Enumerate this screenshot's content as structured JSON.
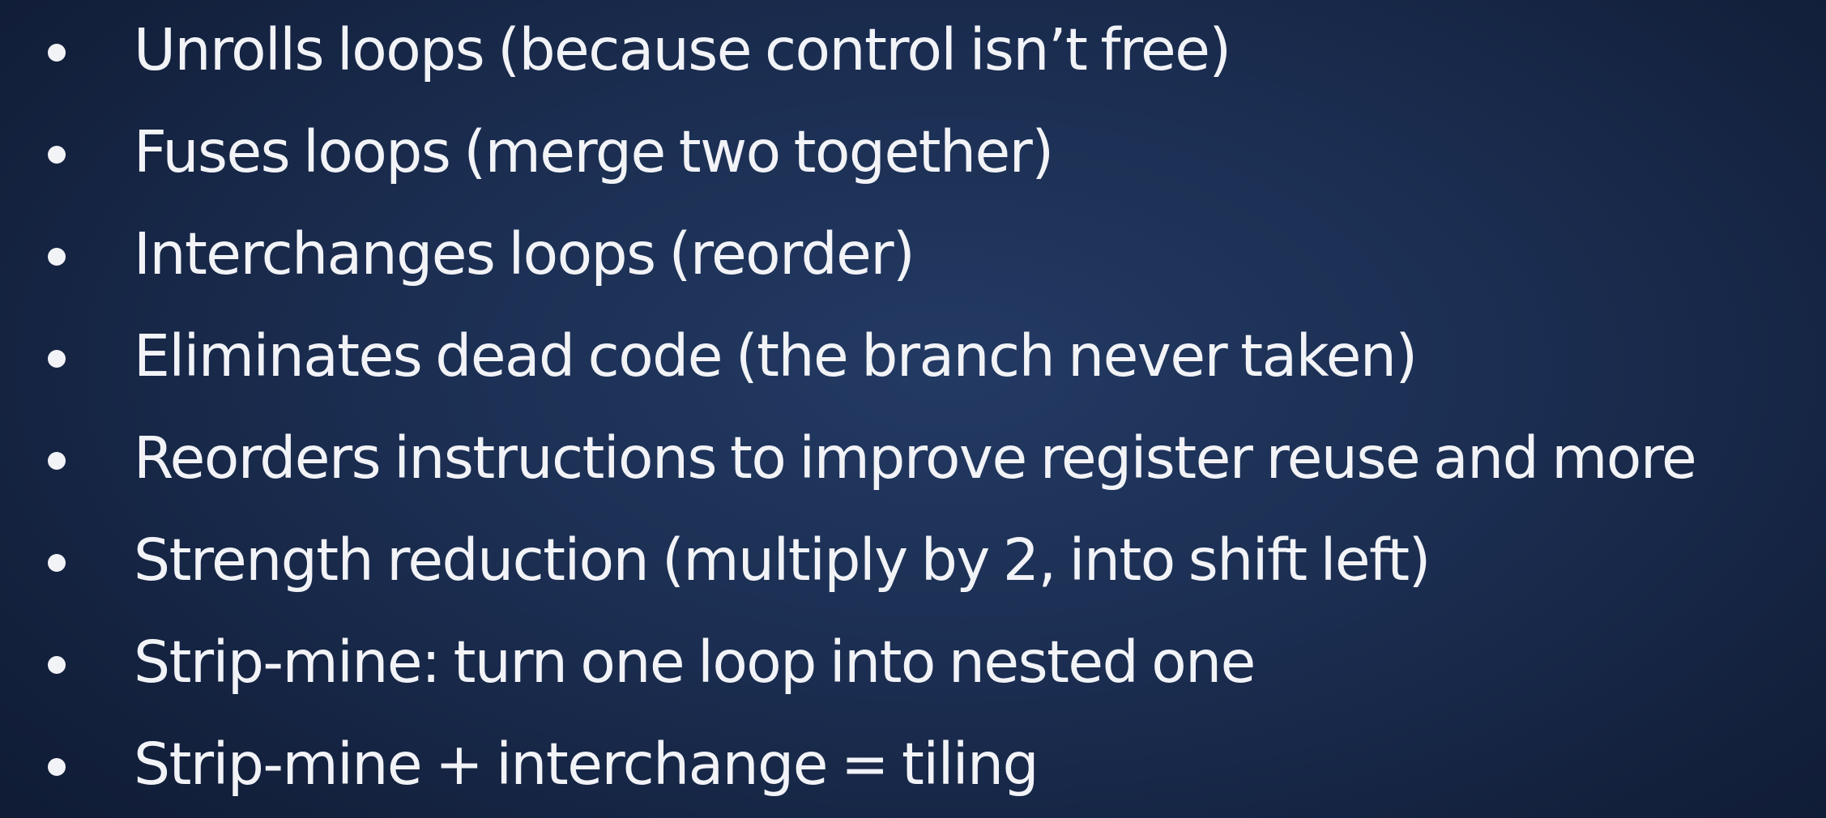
{
  "slide": {
    "bullets": [
      "Unrolls loops (because control isn’t free)",
      "Fuses loops (merge two together)",
      "Interchanges loops (reorder)",
      "Eliminates dead code (the branch never taken)",
      "Reorders instructions to improve register reuse and more",
      "Strength reduction (multiply by 2, into shift left)",
      "Strip-mine: turn one loop into nested one",
      "Strip-mine + interchange = tiling"
    ]
  },
  "colors": {
    "text": "#f2f3f7",
    "background_center": "#233a63",
    "background_edge": "#0e1930"
  }
}
